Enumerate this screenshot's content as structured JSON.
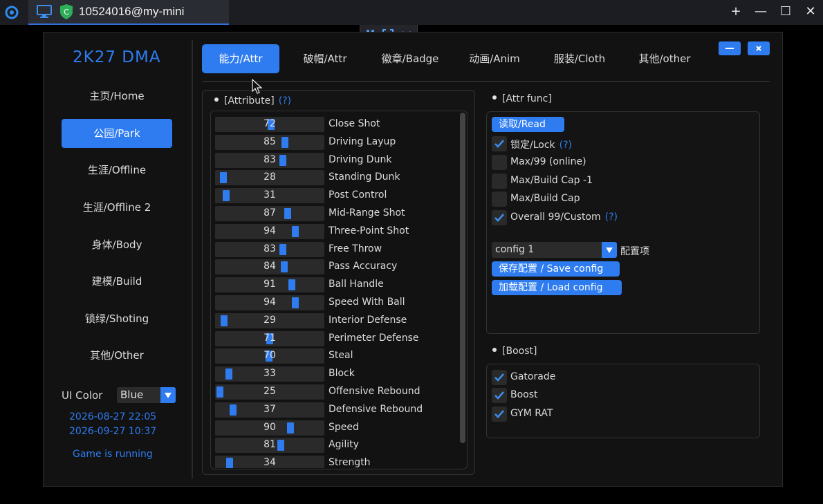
{
  "topbar": {
    "title": "10524016@my-mini",
    "controls": [
      "+",
      "—",
      "☐",
      "✕"
    ]
  },
  "app": {
    "brand": "2K27 DMA",
    "nav": [
      {
        "label": "主页/Home",
        "active": false
      },
      {
        "label": "公园/Park",
        "active": true
      },
      {
        "label": "生涯/Offline",
        "active": false
      },
      {
        "label": "生涯/Offline 2",
        "active": false
      },
      {
        "label": "身体/Body",
        "active": false
      },
      {
        "label": "建模/Build",
        "active": false
      },
      {
        "label": "锁绿/Shoting",
        "active": false
      },
      {
        "label": "其他/Other",
        "active": false
      }
    ],
    "ui_color": {
      "label": "UI Color",
      "value": "Blue"
    },
    "dates": [
      "2026-08-27 22:05",
      "2026-09-27 10:37"
    ],
    "status": "Game is running",
    "accent": "#2e7cf0"
  },
  "tabs": [
    {
      "label": "能力/Attr",
      "active": true
    },
    {
      "label": "破帽/Attr",
      "active": false
    },
    {
      "label": "徽章/Badge",
      "active": false
    },
    {
      "label": "动画/Anim",
      "active": false
    },
    {
      "label": "服装/Cloth",
      "active": false
    },
    {
      "label": "其他/other",
      "active": false
    }
  ],
  "attribute_panel": {
    "title": "[Attribute]",
    "help": "(?)",
    "attributes": [
      {
        "name": "Close Shot",
        "value": 72
      },
      {
        "name": "Driving Layup",
        "value": 85
      },
      {
        "name": "Driving Dunk",
        "value": 83
      },
      {
        "name": "Standing Dunk",
        "value": 28
      },
      {
        "name": "Post Control",
        "value": 31
      },
      {
        "name": "Mid-Range Shot",
        "value": 87
      },
      {
        "name": "Three-Point Shot",
        "value": 94
      },
      {
        "name": "Free Throw",
        "value": 83
      },
      {
        "name": "Pass Accuracy",
        "value": 84
      },
      {
        "name": "Ball Handle",
        "value": 91
      },
      {
        "name": "Speed With Ball",
        "value": 94
      },
      {
        "name": "Interior Defense",
        "value": 29
      },
      {
        "name": "Perimeter Defense",
        "value": 71
      },
      {
        "name": "Steal",
        "value": 70
      },
      {
        "name": "Block",
        "value": 33
      },
      {
        "name": "Offensive Rebound",
        "value": 25
      },
      {
        "name": "Defensive Rebound",
        "value": 37
      },
      {
        "name": "Speed",
        "value": 90
      },
      {
        "name": "Agility",
        "value": 81
      },
      {
        "name": "Strength",
        "value": 34
      }
    ]
  },
  "attr_func": {
    "title": "[Attr func]",
    "read_button": "读取/Read",
    "options": [
      {
        "label": "锁定/Lock",
        "checked": true,
        "help": "(?)"
      },
      {
        "label": "Max/99 (online)",
        "checked": false
      },
      {
        "label": "Max/Build Cap -1",
        "checked": false
      },
      {
        "label": "Max/Build Cap",
        "checked": false
      },
      {
        "label": "Overall 99/Custom",
        "checked": true,
        "help": "(?)"
      }
    ],
    "config_value": "config 1",
    "config_label": "配置项",
    "save_button": "保存配置 / Save config",
    "load_button": "加载配置 / Load config"
  },
  "boost": {
    "title": "[Boost]",
    "options": [
      {
        "label": "Gatorade",
        "checked": true
      },
      {
        "label": "Boost",
        "checked": true
      },
      {
        "label": "GYM RAT",
        "checked": true
      }
    ]
  }
}
